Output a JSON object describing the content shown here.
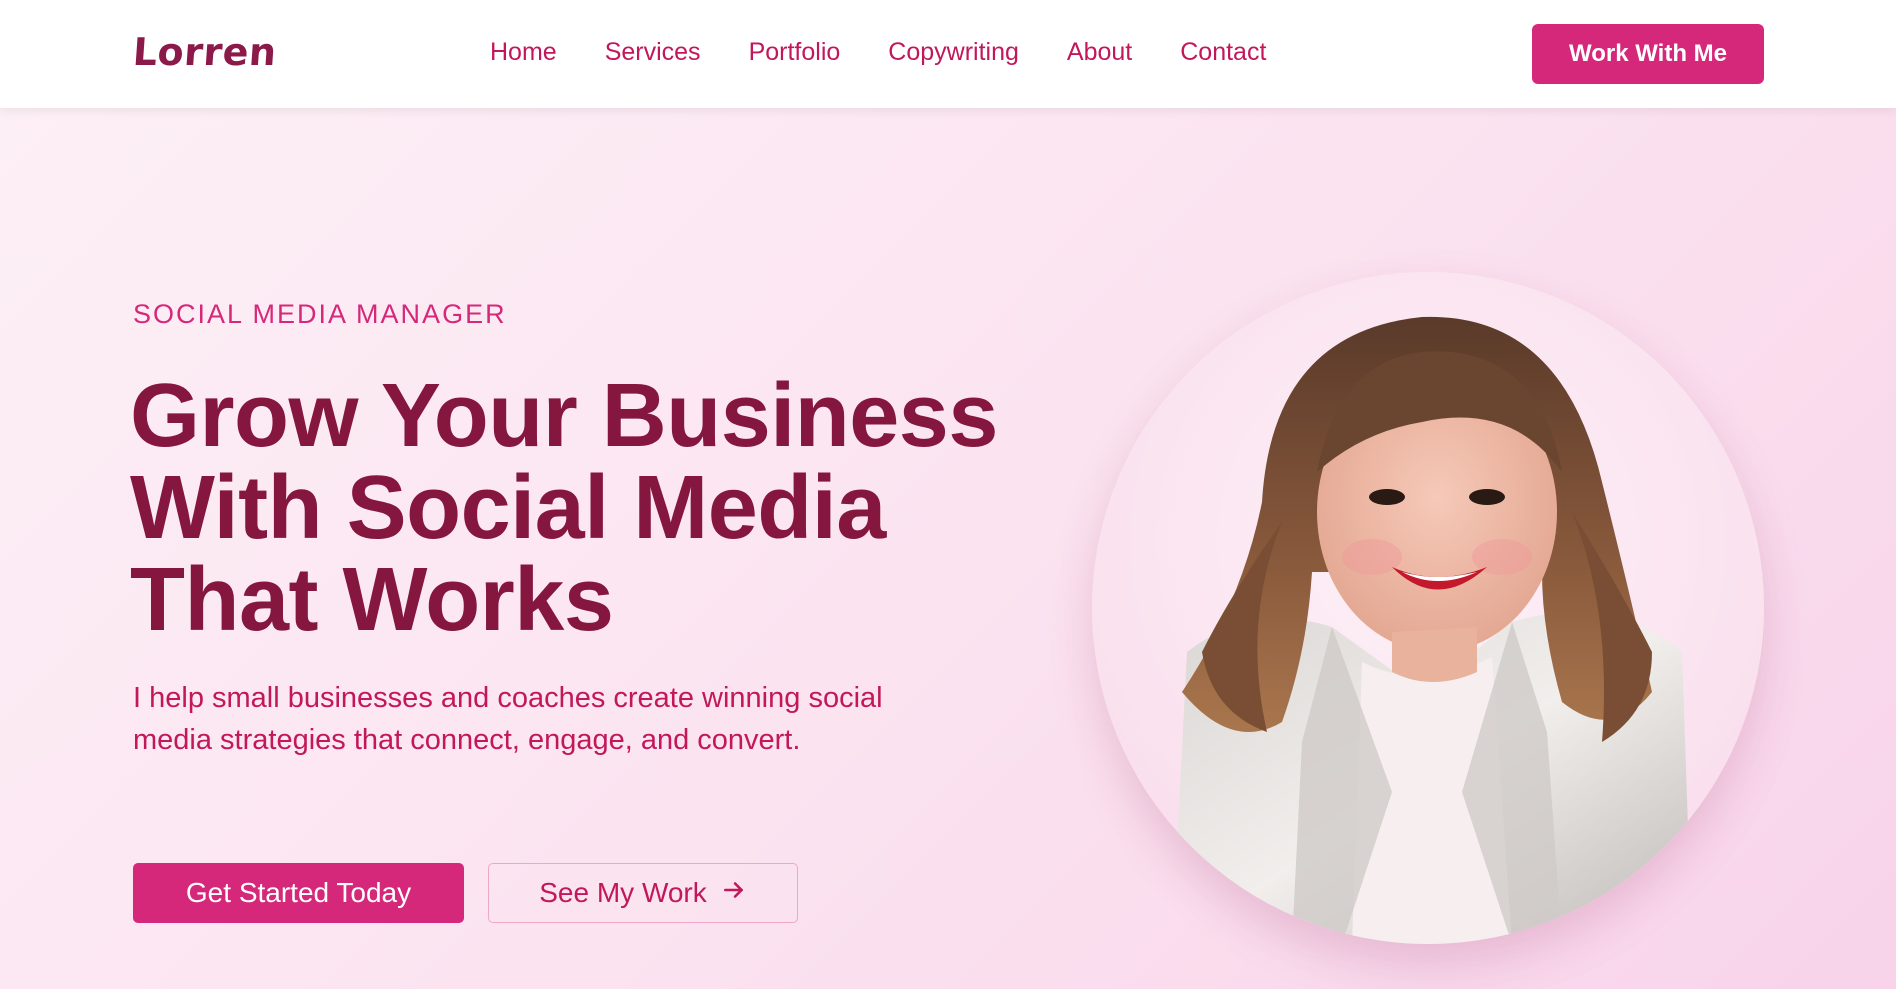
{
  "header": {
    "logo": "Lorren",
    "nav": [
      "Home",
      "Services",
      "Portfolio",
      "Copywriting",
      "About",
      "Contact"
    ],
    "cta_label": "Work With Me"
  },
  "hero": {
    "eyebrow": "SOCIAL MEDIA MANAGER",
    "headline_lines": [
      "Grow Your Business",
      "With Social Media",
      "That Works"
    ],
    "subtext": "I help small businesses and coaches create winning social media strategies that connect, engage, and convert.",
    "primary_button": "Get Started Today",
    "secondary_button": "See My Work",
    "secondary_icon": "arrow-right-icon"
  },
  "colors": {
    "brand_primary": "#d6287a",
    "headline": "#85173f",
    "text": "#c2185b",
    "background": "#fbe3f0"
  }
}
